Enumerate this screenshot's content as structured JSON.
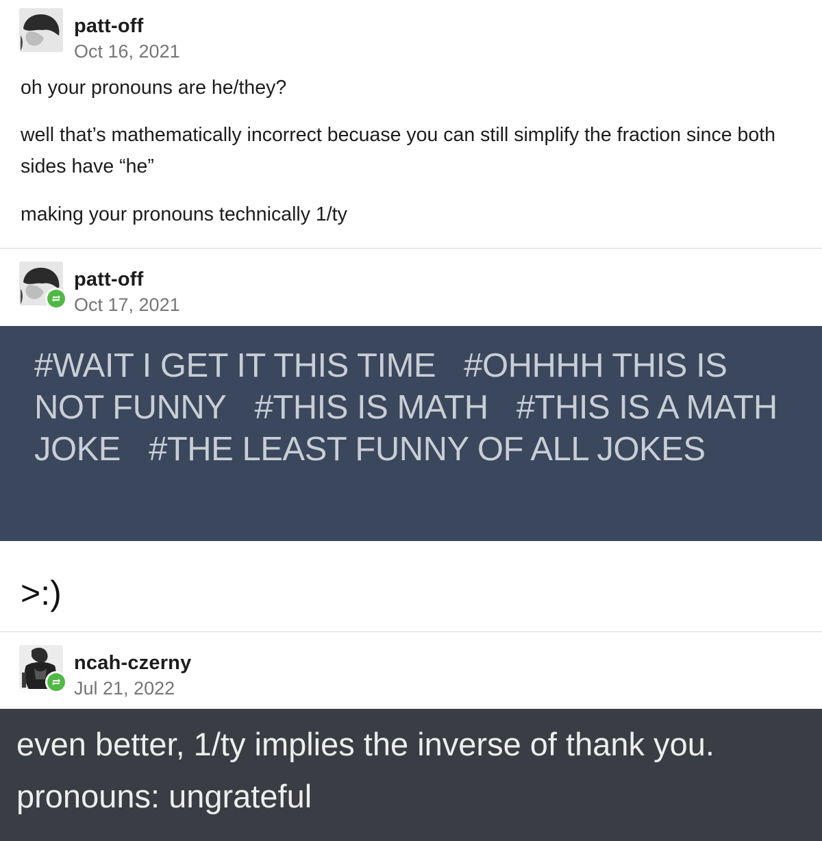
{
  "posts": [
    {
      "username": "patt-off",
      "date": "Oct 16, 2021",
      "paragraphs": [
        "oh your pronouns are he/they?",
        "well that’s mathematically incorrect becuase you can still simplify the fraction since both sides have “he”",
        "making your pronouns technically 1/ty"
      ]
    },
    {
      "username": "patt-off",
      "date": "Oct 17, 2021",
      "reblog_icon": "reblog-icon",
      "tags": [
        "#WAIT I GET IT THIS TIME",
        "#OHHHH THIS IS NOT FUNNY",
        "#THIS IS MATH",
        "#THIS IS A MATH JOKE",
        "#THE LEAST FUNNY OF ALL JOKES"
      ],
      "body": ">:)"
    },
    {
      "username": "ncah-czerny",
      "date": "Jul 21, 2022",
      "reblog_icon": "reblog-icon",
      "lines": [
        "even better, 1/ty implies the inverse of thank you.",
        "pronouns: ungrateful"
      ]
    }
  ],
  "colors": {
    "tags_background": "#3a475c",
    "tags_text": "#c9ced6",
    "dark_background": "#3a3e44",
    "reblog_badge": "#4fb945",
    "date_text": "#757575"
  }
}
